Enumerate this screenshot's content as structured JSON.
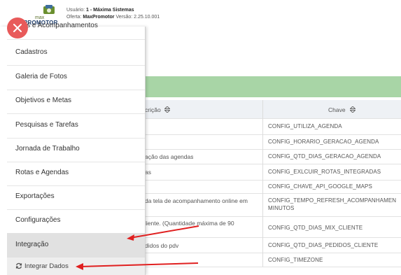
{
  "header": {
    "logo_small": "max",
    "logo_main": "PROMOTOR",
    "user_label": "Usuário:",
    "user_value": "1 - Máxima Sistemas",
    "offer_label": "Oferta:",
    "offer_value": "MaxPromotor",
    "version_label": "Versão:",
    "version_value": "2.25.10.001"
  },
  "menu": {
    "items": [
      {
        "label": "ções e Acompanhamentos"
      },
      {
        "label": "Cadastros"
      },
      {
        "label": "Galeria de Fotos"
      },
      {
        "label": "Objetivos e Metas"
      },
      {
        "label": "Pesquisas e Tarefas"
      },
      {
        "label": "Jornada de Trabalho"
      },
      {
        "label": "Rotas e Agendas"
      },
      {
        "label": "Exportações"
      },
      {
        "label": "Configurações"
      },
      {
        "label": "Integração"
      }
    ],
    "sub_item": "Integrar Dados",
    "close_icon": "close-icon",
    "sync_icon": "sync-icon"
  },
  "table": {
    "columns": [
      "crição",
      "Chave"
    ],
    "sort_icon": "sort-icon",
    "rows": [
      {
        "desc": "",
        "key": "CONFIG_UTILIZA_AGENDA"
      },
      {
        "desc": "",
        "key": "CONFIG_HORARIO_GERACAO_AGENDA"
      },
      {
        "desc": "ação das agendas",
        "key": "CONFIG_QTD_DIAS_GERACAO_AGENDA"
      },
      {
        "desc": "as",
        "key": "CONFIG_EXLCUIR_ROTAS_INTEGRADAS"
      },
      {
        "desc": "",
        "key": "CONFIG_CHAVE_API_GOOGLE_MAPS"
      },
      {
        "desc": "da tela de acompanhamento online em",
        "key": "CONFIG_TEMPO_REFRESH_ACOMPANHAMEN",
        "key2": "MINUTOS"
      },
      {
        "desc": "liente. (Quantidade máxima de 90",
        "key": "CONFIG_QTD_DIAS_MIX_CLIENTE"
      },
      {
        "desc": "didos do pdv",
        "key": "CONFIG_QTD_DIAS_PEDIDOS_CLIENTE"
      },
      {
        "desc": "",
        "key": "CONFIG_TIMEZONE"
      }
    ]
  },
  "colors": {
    "accent_green": "#a8d5a6",
    "close_red": "#e85a5a",
    "arrow_red": "#e02020",
    "menu_active": "#e1e1e1"
  }
}
